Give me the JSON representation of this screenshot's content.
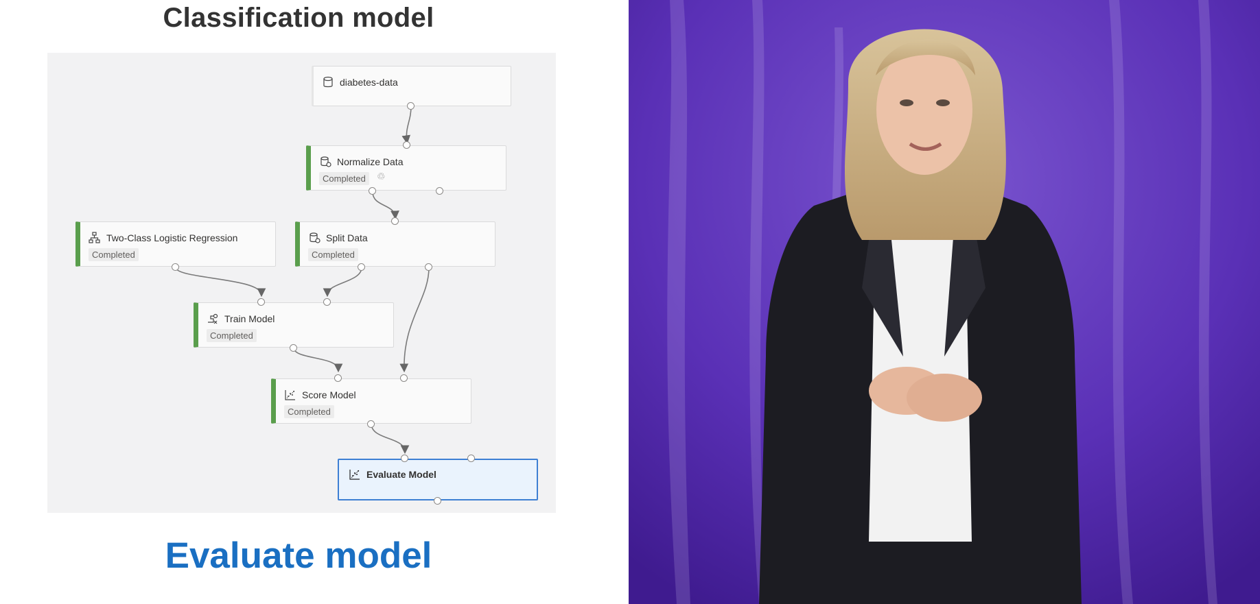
{
  "slide": {
    "title": "Classification model",
    "subtitle": "Evaluate model"
  },
  "pipeline": {
    "nodes": {
      "dataset": {
        "label": "diabetes-data",
        "icon": "database-icon"
      },
      "normalize": {
        "label": "Normalize Data",
        "status": "Completed",
        "icon": "data-transform-icon"
      },
      "logistic": {
        "label": "Two-Class Logistic Regression",
        "status": "Completed",
        "icon": "tree-icon"
      },
      "split": {
        "label": "Split Data",
        "status": "Completed",
        "icon": "data-transform-icon"
      },
      "train": {
        "label": "Train Model",
        "status": "Completed",
        "icon": "train-icon"
      },
      "score": {
        "label": "Score Model",
        "status": "Completed",
        "icon": "scatter-chart-icon"
      },
      "evaluate": {
        "label": "Evaluate Model",
        "icon": "scatter-chart-icon"
      }
    }
  },
  "colors": {
    "title_text": "#333333",
    "subtitle_text": "#1a6fc2",
    "completed_bar": "#5a9e4c",
    "selected_border": "#3d7fd3",
    "video_background": "#5b2fb3"
  }
}
